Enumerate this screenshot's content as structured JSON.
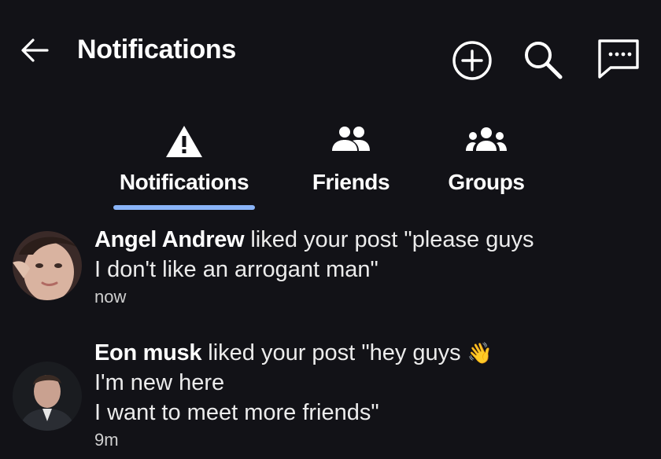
{
  "header": {
    "title": "Notifications",
    "icons": {
      "back": "arrow-left-icon",
      "add": "add-circle-icon",
      "search": "search-icon",
      "chat": "chat-bubble-icon"
    }
  },
  "tabs": [
    {
      "label": "Notifications",
      "icon": "warning-icon",
      "active": true
    },
    {
      "label": "Friends",
      "icon": "friends-icon",
      "active": false
    },
    {
      "label": "Groups",
      "icon": "groups-icon",
      "active": false
    }
  ],
  "colors": {
    "background": "#121217",
    "accent": "#8ab4f8",
    "wave_emoji": "#f5c518"
  },
  "notifications": [
    {
      "name": "Angel Andrew",
      "action": "liked your post",
      "post_text_lines": [
        "\"please guys",
        "I don't like an arrogant man\""
      ],
      "time": "now"
    },
    {
      "name": "Eon musk",
      "action": "liked your post",
      "post_text_lines": [
        "\"hey guys",
        "I'm new here",
        "I want to meet more friends\""
      ],
      "emoji": "👋",
      "time": "9m"
    }
  ]
}
